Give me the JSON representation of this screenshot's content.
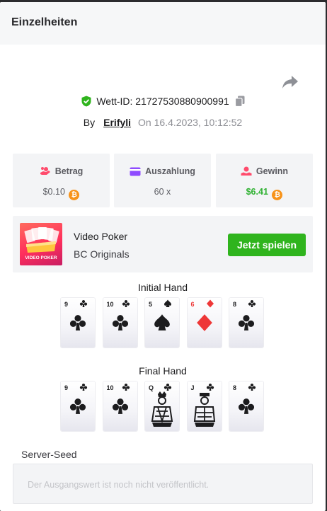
{
  "header": {
    "title": "Einzelheiten"
  },
  "bet": {
    "id_prefix": "Wett-ID:",
    "id": "21727530880900991",
    "by_label": "By",
    "user": "Erifyli",
    "on_label": "On",
    "datetime": "16.4.2023, 10:12:52"
  },
  "stats": [
    {
      "label": "Betrag",
      "value": "$0.10",
      "icon": "bet-hand-icon",
      "color": "#ff4b6c",
      "currency": "btc-icon"
    },
    {
      "label": "Auszahlung",
      "value": "60 x",
      "icon": "card-payout-icon",
      "color": "#8f4bff"
    },
    {
      "label": "Gewinn",
      "value": "$6.41",
      "icon": "win-hand-icon",
      "color": "#ff4b6c",
      "value_color": "#2fb132",
      "currency": "btc-icon"
    }
  ],
  "btc_symbol": "₿",
  "game": {
    "name": "Video Poker",
    "provider": "BC Originals",
    "thumb_label": "VIDEO POKER",
    "play_label": "Jetzt spielen"
  },
  "initial_hand": {
    "title": "Initial Hand",
    "cards": [
      {
        "rank": "9",
        "suit": "clubs"
      },
      {
        "rank": "10",
        "suit": "clubs"
      },
      {
        "rank": "5",
        "suit": "spades"
      },
      {
        "rank": "6",
        "suit": "diamonds"
      },
      {
        "rank": "8",
        "suit": "clubs"
      }
    ]
  },
  "final_hand": {
    "title": "Final Hand",
    "cards": [
      {
        "rank": "9",
        "suit": "clubs"
      },
      {
        "rank": "10",
        "suit": "clubs"
      },
      {
        "rank": "Q",
        "suit": "clubs"
      },
      {
        "rank": "J",
        "suit": "clubs"
      },
      {
        "rank": "8",
        "suit": "clubs"
      }
    ]
  },
  "server_seed": {
    "label": "Server-Seed",
    "value": "Der Ausgangswert ist noch nicht veröffentlicht."
  },
  "colors": {
    "accent_green": "#2fb41d",
    "win_green": "#2fb132",
    "red_suit": "#ee3737"
  }
}
